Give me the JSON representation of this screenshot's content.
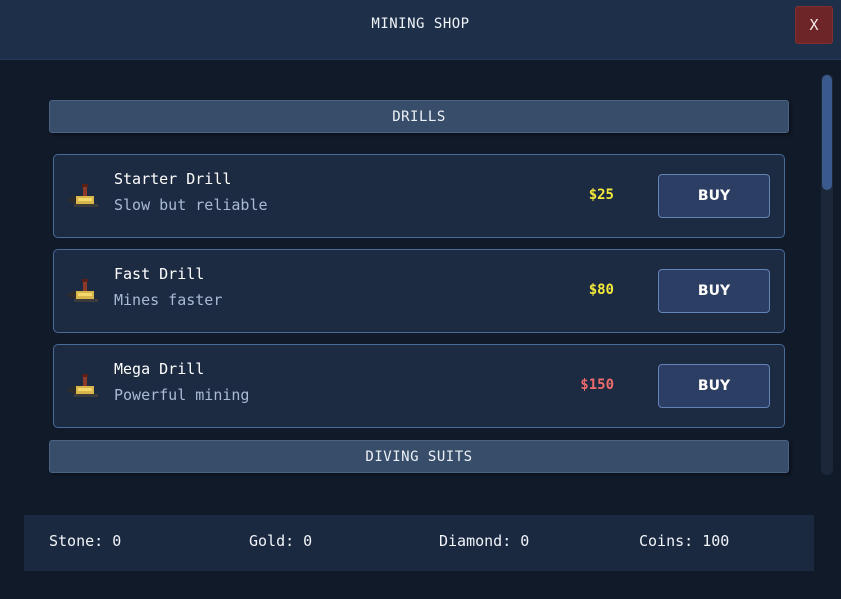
{
  "header": {
    "title": "MINING SHOP",
    "close_label": "X"
  },
  "sections": [
    {
      "title": "DRILLS",
      "items": [
        {
          "name": "Starter Drill",
          "description": "Slow but reliable",
          "price": "$25",
          "price_color": "#f2e93a",
          "buy_label": "BUY",
          "icon": "drill-icon"
        },
        {
          "name": "Fast Drill",
          "description": "Mines faster",
          "price": "$80",
          "price_color": "#f2e93a",
          "buy_label": "BUY",
          "icon": "drill-icon"
        },
        {
          "name": "Mega Drill",
          "description": "Powerful mining",
          "price": "$150",
          "price_color": "#ee6b6b",
          "buy_label": "BUY",
          "icon": "drill-icon"
        }
      ]
    },
    {
      "title": "DIVING SUITS",
      "items": []
    }
  ],
  "footer": {
    "stone": "Stone: 0",
    "gold": "Gold: 0",
    "diamond": "Diamond: 0",
    "coins": "Coins: 100"
  },
  "colors": {
    "background": "#111a29",
    "header": "#1e2f49",
    "close": "#6d2527",
    "price_affordable": "#f2e93a",
    "price_unaffordable": "#ee6b6b"
  }
}
